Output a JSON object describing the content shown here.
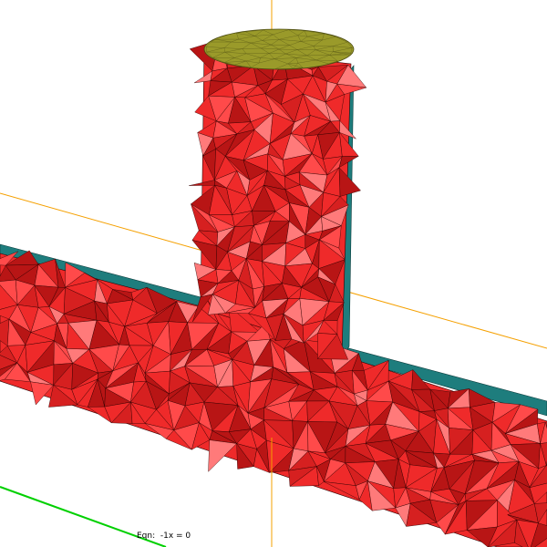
{
  "viewer": {
    "equation_label": "Eqn:  -1x = 0"
  },
  "colors": {
    "background": "#ffffff",
    "mesh_fill": "#ef2a2a",
    "mesh_dark": "#b81515",
    "mesh_light": "#ff7a7a",
    "mesh_edge": "#2a0000",
    "cut_face": "#1e7d7d",
    "cut_edge": "#0a3a3a",
    "cap_face": "#9a9a2a",
    "cap_edge": "#4a4a10",
    "axis_orange": "#f5a000",
    "axis_green": "#00d000"
  }
}
